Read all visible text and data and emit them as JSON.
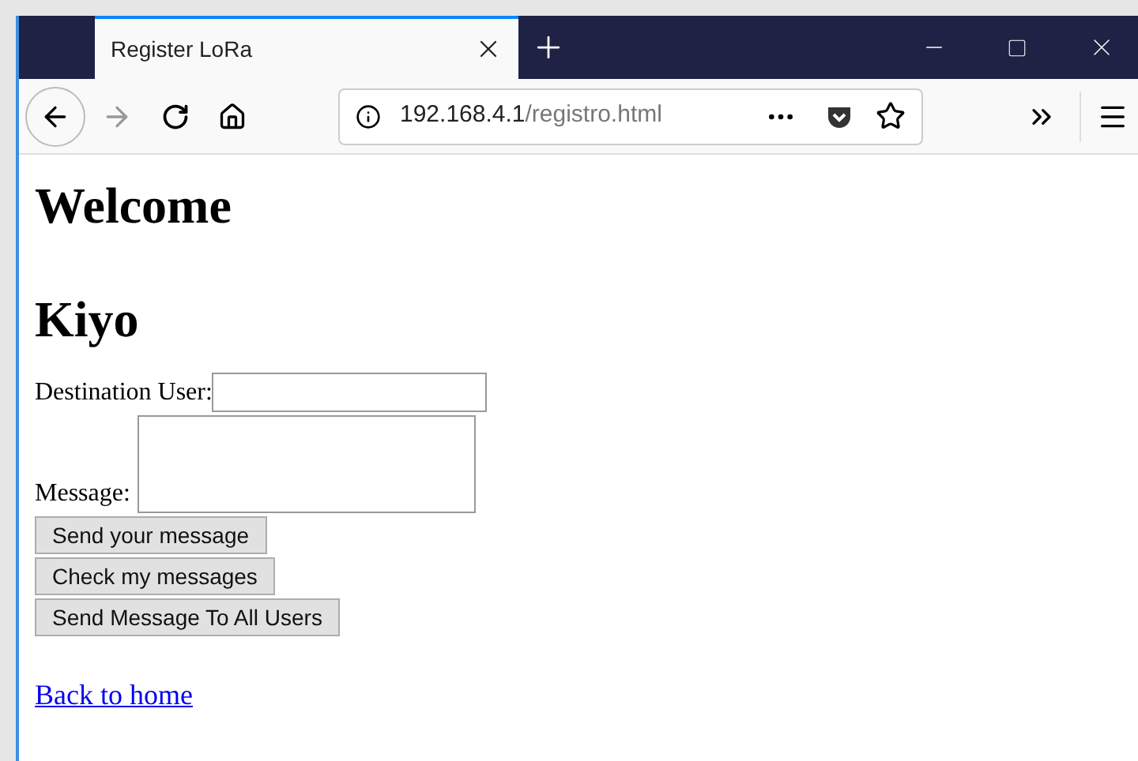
{
  "tab": {
    "title": "Register LoRa",
    "selected": true
  },
  "address": {
    "host": "192.168.4.1",
    "path": "/registro.html"
  },
  "headings": [
    "Welcome",
    "Kiyo"
  ],
  "form": {
    "destination_label": "Destination User:",
    "message_label": "Message:"
  },
  "buttons": [
    "Send your message",
    "Check my messages",
    "Send Message To All Users"
  ],
  "link": "Back to home"
}
